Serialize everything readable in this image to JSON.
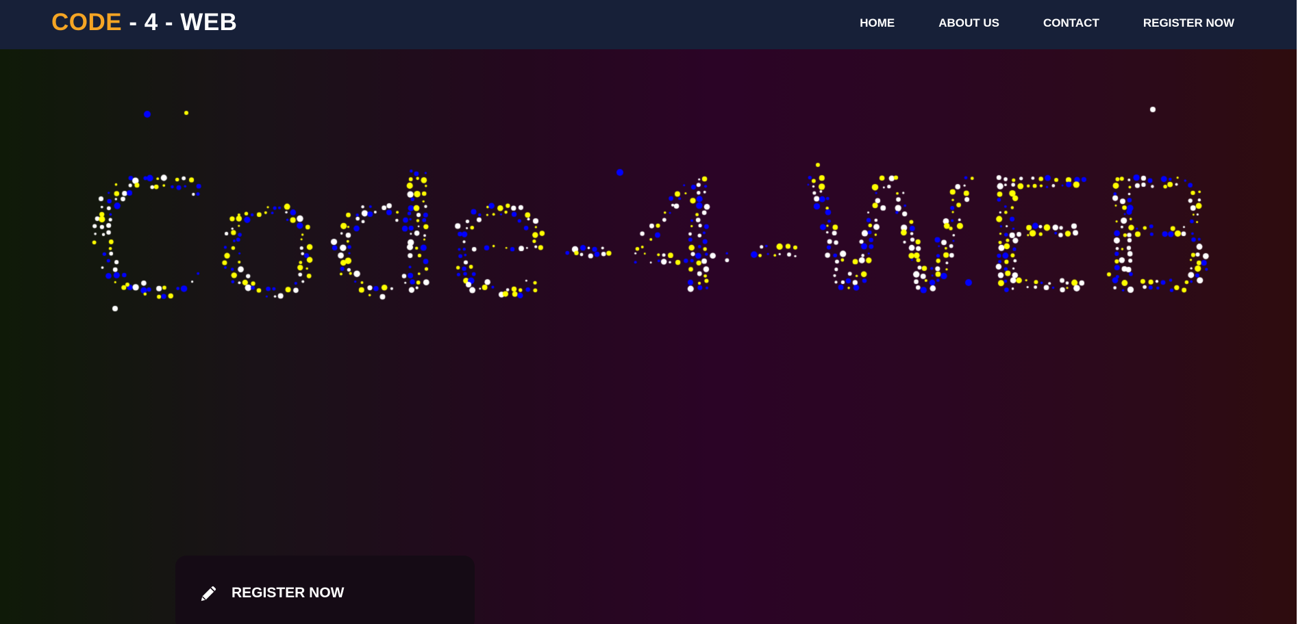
{
  "navbar": {
    "brand_code": "CODE",
    "brand_rest": " - 4 - WEB",
    "links": [
      "HOME",
      "ABOUT US",
      "CONTACT",
      "REGISTER NOW"
    ]
  },
  "hero": {
    "particle_text": "Code-4-WEB",
    "particle_colors": [
      "#ffffff",
      "#0000ff",
      "#ffff00"
    ],
    "register_button_label": "REGISTER NOW",
    "register_icon": "pencil-icon"
  },
  "colors": {
    "accent": "#f5a524",
    "navbar_bg": "#172038"
  }
}
